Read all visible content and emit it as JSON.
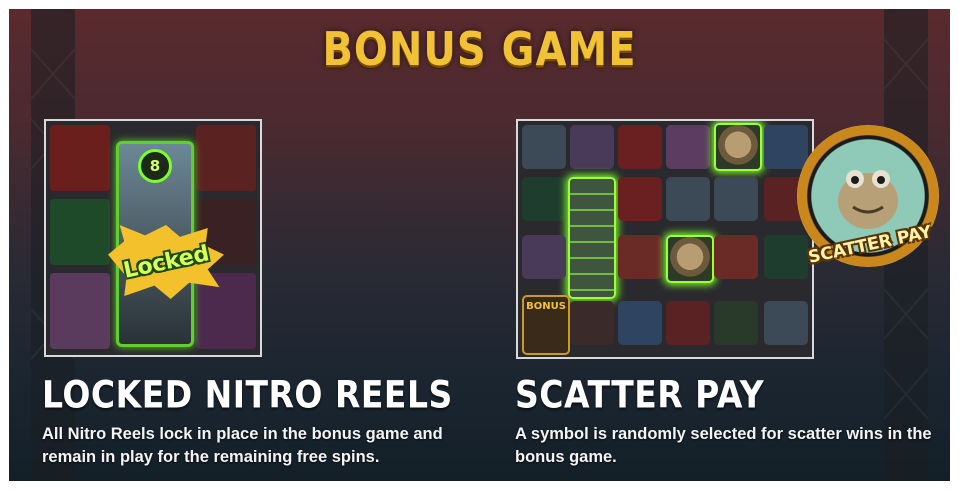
{
  "screen": {
    "title": "BONUS GAME",
    "accent_color": "#f2c236",
    "glow_color": "#7dff2a"
  },
  "left_feature": {
    "heading": "LOCKED NITRO REELS",
    "description": "All Nitro Reels lock in place in the bonus game and remain in play for the remaining free spins.",
    "badge_text": "Locked",
    "reel_counter": "8"
  },
  "right_feature": {
    "heading": "SCATTER PAY",
    "description": "A symbol is randomly selected for scatter wins in the bonus game.",
    "medal_text": "SCATTER PAY",
    "bonus_symbol_text": "BONUS"
  }
}
